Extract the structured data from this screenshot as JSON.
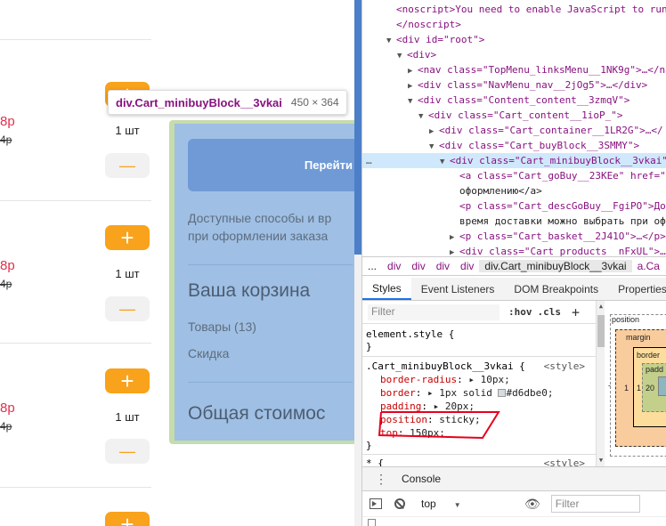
{
  "shop": {
    "items": [
      {
        "price": "8р",
        "old_price": "4р",
        "qty": "1 шт"
      },
      {
        "price": "8р",
        "old_price": "4р",
        "qty": "1 шт"
      },
      {
        "price": "8р",
        "old_price": "4р",
        "qty": "1 шт"
      }
    ],
    "plus_symbol": "+",
    "minus_symbol": "—",
    "sidebar": {
      "go_button": "Перейти",
      "desc_line1": "Доступные способы и вр",
      "desc_line2": "при оформлении заказа",
      "cart_title": "Ваша корзина",
      "goods_label": "Товары (13)",
      "discount_label": "Скидка",
      "total_title": "Общая стоимос"
    }
  },
  "tooltip": {
    "name": "div.Cart_minibuyBlock__3vkai",
    "size": "450 × 364"
  },
  "elements_panel": {
    "lines": [
      {
        "text": "<noscript>You need to enable JavaScript to run"
      },
      {
        "text": "</noscript>"
      },
      {
        "text": "<div id=\"root\">"
      },
      {
        "text": "<div>"
      },
      {
        "text": "<nav class=\"TopMenu_linksMenu__1NK9g\">…</na"
      },
      {
        "text": "<div class=\"NavMenu_nav__2jOg5\">…</div>"
      },
      {
        "text": "<div class=\"Content_content__3zmqV\">"
      },
      {
        "text": "<div class=\"Cart_content__1ioP_\">"
      },
      {
        "text": "<div class=\"Cart_container__1LR2G\">…</"
      },
      {
        "text": "<div class=\"Cart_buyBlock__3SMMY\">"
      },
      {
        "text": "<div class=\"Cart_minibuyBlock__3vkai\""
      },
      {
        "text": "<a class=\"Cart_goBuy__23KEe\" href=\""
      },
      {
        "text": "оформлению</a>"
      },
      {
        "text": "<p class=\"Cart_descGoBuy__FgiPO\">До"
      },
      {
        "text": "время доставки можно выбрать при оф"
      },
      {
        "text": "<p class=\"Cart_basket__2J41O\">…</p>"
      },
      {
        "text": "<div class=\"Cart_products__nFxUL\">…"
      }
    ],
    "gutter_dots": "…"
  },
  "breadcrumb": {
    "items": [
      "...",
      "div",
      "div",
      "div",
      "div"
    ],
    "active": "div.Cart_minibuyBlock__3vkai",
    "tail": "a.Ca"
  },
  "tabs": [
    "Styles",
    "Event Listeners",
    "DOM Breakpoints",
    "Properties"
  ],
  "styles": {
    "filter_placeholder": "Filter",
    "hov": ":hov",
    "cls": ".cls",
    "plus": "+",
    "element_style": "element.style {",
    "close_brace": "}",
    "rule_selector": ".Cart_minibuyBlock__3vkai {",
    "rule_source": "<style>",
    "props": [
      {
        "name": "border-radius",
        "value": "▸ 10px;"
      },
      {
        "name": "border",
        "value": "▸ 1px solid",
        "swatch": "#d6dbe0",
        "swatch_text": "#d6dbe0;"
      },
      {
        "name": "padding",
        "value": "▸ 20px;"
      },
      {
        "name": "position",
        "value": "sticky;"
      },
      {
        "name": "top",
        "value": "150px;"
      }
    ],
    "next_selector": "* {",
    "next_source": "<style>"
  },
  "box_model": {
    "position_label": "position",
    "margin_label": "margin",
    "border_label": "border",
    "padding_label": "padd",
    "dash": "-",
    "one": "1",
    "twenty": "20"
  },
  "console": {
    "menu_icon": "⋮",
    "tab": "Console",
    "context": "top",
    "context_arrow": "▼",
    "eye_icon": "👁",
    "filter_placeholder": "Filter"
  },
  "colors": {
    "accent_orange": "#f9a21b",
    "price_red": "#e0314b",
    "highlight_blue": "#9fbfe4",
    "highlight_green": "#c5dcab",
    "devtools_selected": "#cfe8fc",
    "annotation_red": "#e8001c"
  }
}
